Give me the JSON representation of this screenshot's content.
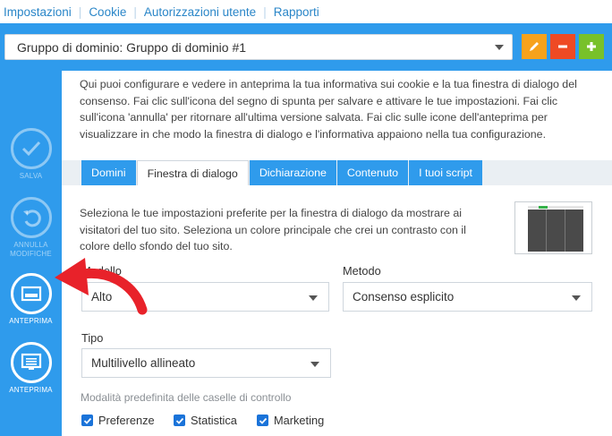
{
  "topnav": {
    "items": [
      {
        "label": "Impostazioni"
      },
      {
        "label": "Cookie"
      },
      {
        "label": "Autorizzazioni utente"
      },
      {
        "label": "Rapporti"
      }
    ]
  },
  "domain": {
    "selected": "Gruppo di dominio: Gruppo di dominio #1",
    "buttons": {
      "edit_icon": "pencil-icon",
      "remove_icon": "minus-icon",
      "add_icon": "plus-icon"
    }
  },
  "sidebar": {
    "save_label": "SALVA",
    "cancel_label_1": "ANNULLA",
    "cancel_label_2": "MODIFICHE",
    "preview1_label": "ANTEPRIMA",
    "preview2_label": "ANTEPRIMA"
  },
  "intro": "Qui puoi configurare e vedere in anteprima la tua informativa sui cookie e la tua finestra di dialogo del consenso. Fai clic sull'icona del segno di spunta per salvare e attivare le tue impostazioni. Fai clic sull'icona 'annulla' per ritornare all'ultima versione salvata. Fai clic sulle icone dell'anteprima per visualizzare in che modo la finestra di dialogo e l'informativa appaiono nella tua configurazione.",
  "tabs": [
    {
      "label": "Domini"
    },
    {
      "label": "Finestra di dialogo"
    },
    {
      "label": "Dichiarazione"
    },
    {
      "label": "Contenuto"
    },
    {
      "label": "I tuoi script"
    }
  ],
  "lead": "Seleziona le tue impostazioni preferite per la finestra di dialogo da mostrare ai visitatori del tuo sito. Seleziona un colore principale che crei un contrasto con il colore dello sfondo del tuo sito.",
  "fields": {
    "modello": {
      "label": "Modello",
      "value": "Alto"
    },
    "metodo": {
      "label": "Metodo",
      "value": "Consenso esplicito"
    },
    "tipo": {
      "label": "Tipo",
      "value": "Multilivello allineato"
    }
  },
  "checkbox_section": "Modalità predefinita delle caselle di controllo",
  "checkboxes": [
    {
      "label": "Preferenze"
    },
    {
      "label": "Statistica"
    },
    {
      "label": "Marketing"
    }
  ],
  "colors": {
    "accent": "#2f9bec",
    "edit": "#f7a21c",
    "remove": "#ef4a24",
    "add": "#78c12a",
    "arrow": "#e8222a"
  }
}
